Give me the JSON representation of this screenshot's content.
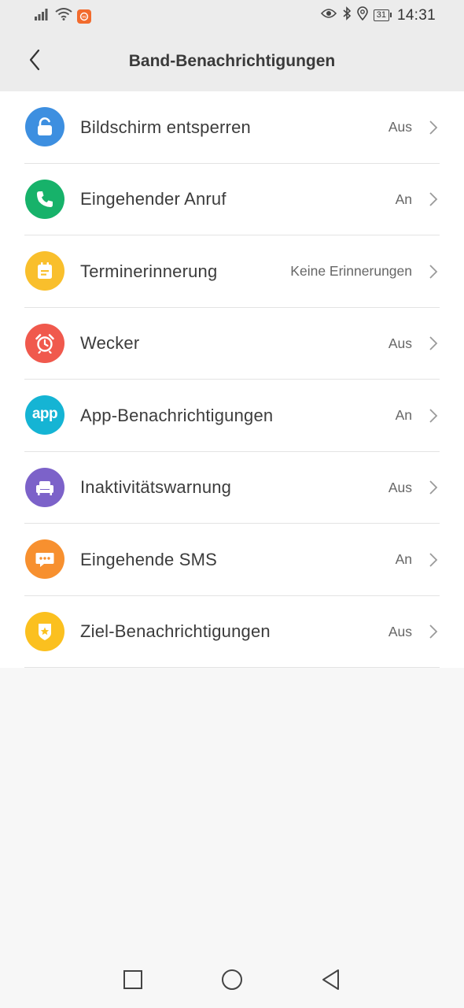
{
  "status_bar": {
    "time": "14:31",
    "battery": "31",
    "app_badge": "mi",
    "icons": [
      "signal-icon",
      "wifi-icon",
      "app-notification-icon",
      "eye-icon",
      "bluetooth-icon",
      "location-icon",
      "battery-icon"
    ]
  },
  "header": {
    "title": "Band-Benachrichtigungen",
    "back_icon": "chevron-left-icon"
  },
  "items": [
    {
      "label": "Bildschirm entsperren",
      "value": "Aus",
      "icon": "unlock-icon",
      "color": "#3d8fe0"
    },
    {
      "label": "Eingehender Anruf",
      "value": "An",
      "icon": "phone-icon",
      "color": "#17b26a"
    },
    {
      "label": "Terminerinnerung",
      "value": "Keine Erinnerungen",
      "icon": "calendar-icon",
      "color": "#f9bf2c"
    },
    {
      "label": "Wecker",
      "value": "Aus",
      "icon": "alarm-clock-icon",
      "color": "#f0594d"
    },
    {
      "label": "App-Benachrichtigungen",
      "value": "An",
      "icon": "app-icon",
      "color": "#15b4d4"
    },
    {
      "label": "Inaktivitätswarnung",
      "value": "Aus",
      "icon": "sofa-icon",
      "color": "#7c62c9"
    },
    {
      "label": "Eingehende SMS",
      "value": "An",
      "icon": "message-icon",
      "color": "#f7902f"
    },
    {
      "label": "Ziel-Benachrichtigungen",
      "value": "Aus",
      "icon": "goal-badge-icon",
      "color": "#fbc01f"
    }
  ],
  "app_icon_text": "app",
  "nav_bar": {
    "icons": [
      "recent-apps-icon",
      "home-icon",
      "back-icon"
    ]
  }
}
